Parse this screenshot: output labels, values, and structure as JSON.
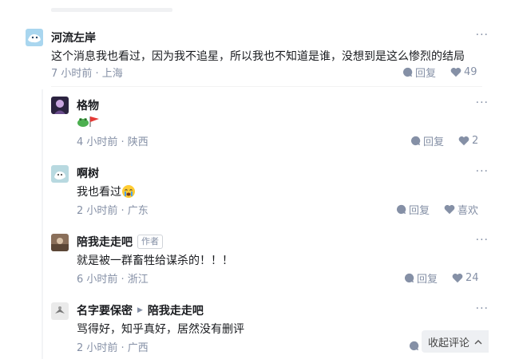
{
  "comments": [
    {
      "author": "河流左岸",
      "text": "这个消息我也看过，因为我不追星，所以我也不知道是谁，没想到是这么惨烈的结局",
      "meta": "7 小时前 · 上海",
      "reply": "回复",
      "likes": "49",
      "avatar_color": "#a9d6ef"
    },
    {
      "author": "格物",
      "text": "",
      "meta": "4 小时前 · 陕西",
      "reply": "回复",
      "likes": "2",
      "avatar_color": "#2b2340"
    },
    {
      "author": "啊树",
      "text": "我也看过",
      "meta": "2 小时前 · 广东",
      "reply": "回复",
      "likes": "喜欢",
      "avatar_color": "#b8d9e0"
    },
    {
      "author": "陪我走走吧",
      "badge": "作者",
      "text": "就是被一群畜牲给谋杀的！！！",
      "meta": "6 小时前 · 浙江",
      "reply": "回复",
      "likes": "24",
      "avatar_color": "#8a6f5a"
    },
    {
      "author": "名字要保密",
      "reply_to": "陪我走走吧",
      "text": "骂得好，知乎真好，居然没有删评",
      "meta": "2 小时前 · 广西",
      "avatar_color": "#eaeaea"
    }
  ],
  "more_label": "···",
  "collapse": {
    "label": "收起评论"
  },
  "colors": {
    "muted": "#8590a6",
    "text": "#191b1f",
    "button_bg": "#eef0f3"
  }
}
